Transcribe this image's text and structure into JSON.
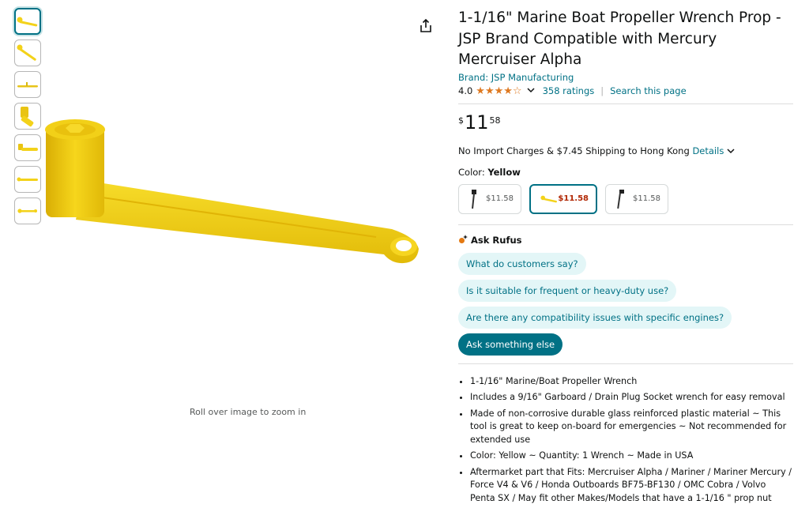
{
  "product": {
    "title": "1-1/16\" Marine Boat Propeller Wrench Prop - JSP Brand Compatible with Mercury Mercruiser Alpha",
    "brand": "Brand: JSP Manufacturing",
    "rating": "4.0",
    "rating_stars": 4,
    "ratings_count": "358 ratings",
    "search_page": "Search this page",
    "price": {
      "symbol": "$",
      "whole": "11",
      "fraction": "58"
    },
    "shipping_text": "No Import Charges & $7.45 Shipping to Hong Kong",
    "shipping_details": "Details",
    "color_label": "Color: ",
    "color_value": "Yellow",
    "swatches": [
      {
        "price": "$11.58",
        "selected": false,
        "icon": "black-wrench-icon"
      },
      {
        "price": "$11.58",
        "selected": true,
        "icon": "yellow-wrench-icon"
      },
      {
        "price": "$11.58",
        "selected": false,
        "icon": "black-wrench-icon"
      }
    ]
  },
  "gallery": {
    "zoom_hint": "Roll over image to zoom in",
    "thumbnail_count": 7
  },
  "rufus": {
    "title": "Ask Rufus",
    "chips": [
      "What do customers say?",
      "Is it suitable for frequent or heavy-duty use?",
      "Are there any compatibility issues with specific engines?"
    ],
    "ask_button": "Ask something else"
  },
  "bullets": [
    "1-1/16\" Marine/Boat Propeller Wrench",
    "Includes a 9/16\" Garboard / Drain Plug Socket wrench for easy removal",
    "Made of non-corrosive durable glass reinforced plastic material ~ This tool is great to keep on-board for emergencies ~ Not recommended for extended use",
    "Color: Yellow ~ Quantity: 1 Wrench ~ Made in USA",
    "Aftermarket part that Fits: Mercruiser Alpha / Mariner / Mariner Mercury / Force V4 & V6 / Honda Outboards BF75-BF130 / OMC Cobra / Volvo Penta SX / May fit other Makes/Models that have a 1-1/16 \" prop nut"
  ],
  "colors": {
    "link": "#007185",
    "star": "#de7921",
    "price_red": "#B12704",
    "wrench_yellow": "#f3d21a"
  }
}
